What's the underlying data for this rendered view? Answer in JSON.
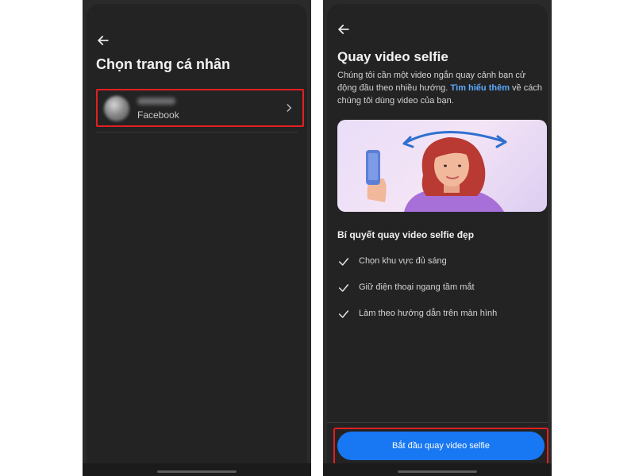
{
  "left_screen": {
    "back_icon": "arrow-left-icon",
    "title": "Chọn trang cá nhân",
    "profile": {
      "platform": "Facebook",
      "chevron_icon": "chevron-right-icon"
    }
  },
  "right_screen": {
    "back_icon": "arrow-left-icon",
    "title": "Quay video selfie",
    "description_before": "Chúng tôi cần một video ngắn quay cảnh bạn cử động đầu theo nhiều hướng. ",
    "description_link": "Tìm hiểu thêm",
    "description_after": " về cách chúng tôi dùng video của bạn.",
    "tips_title": "Bí quyết quay video selfie đẹp",
    "tips": [
      "Chọn khu vực đủ sáng",
      "Giữ điện thoại ngang tầm mắt",
      "Làm theo hướng dẫn trên màn hình"
    ],
    "start_button": "Bắt đầu quay video selfie"
  },
  "colors": {
    "background": "#232324",
    "link": "#5aa9ff",
    "button": "#1877f2",
    "highlight": "#e02020"
  }
}
